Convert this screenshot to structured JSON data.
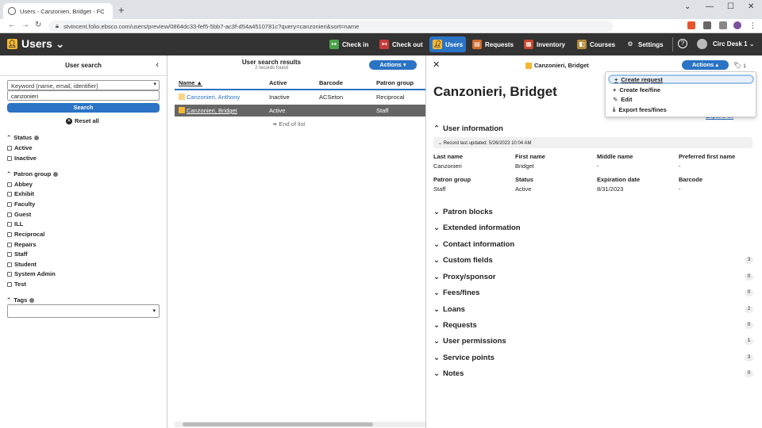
{
  "browser": {
    "tab_title": "Users - Canzonieri, Bridget - FOLIO",
    "url": "stvincent.folio.ebsco.com/users/preview/0864dc33-fef5-5bb7-ac3f-d54a4510781c?query=canzonieri&sort=name"
  },
  "app": {
    "name": "Users",
    "nav": [
      {
        "label": "Check in",
        "color": "#4aa34a"
      },
      {
        "label": "Check out",
        "color": "#c63a3a"
      },
      {
        "label": "Users",
        "color": "#f5b731"
      },
      {
        "label": "Requests",
        "color": "#d06d2d"
      },
      {
        "label": "Inventory",
        "color": "#c8442c"
      },
      {
        "label": "Courses",
        "color": "#b58b3a"
      },
      {
        "label": "Settings",
        "color": "#333"
      }
    ],
    "service_point": "Circ Desk 1"
  },
  "search": {
    "title": "User search",
    "keyword_placeholder": "Keyword (name, email, identifier)",
    "query": "canzonieri",
    "search_label": "Search",
    "reset_label": "Reset all",
    "status_label": "Status",
    "status_options": [
      "Active",
      "Inactive"
    ],
    "patron_group_label": "Patron group",
    "patron_groups": [
      "Abbey",
      "Exhibit",
      "Faculty",
      "Guest",
      "ILL",
      "Reciprocal",
      "Repairs",
      "Staff",
      "Student",
      "System Admin",
      "Test"
    ],
    "tags_label": "Tags"
  },
  "results": {
    "title": "User search results",
    "count": "2 records found",
    "actions_label": "Actions",
    "columns": [
      "Name",
      "Active",
      "Barcode",
      "Patron group"
    ],
    "rows": [
      {
        "name": "Canzonieri, Anthony",
        "active": "Inactive",
        "barcode": "ACSeton",
        "group": "Reciprocal"
      },
      {
        "name": "Canzonieri, Bridget",
        "active": "Active",
        "barcode": "",
        "group": "Staff"
      }
    ],
    "end_label": "End of list"
  },
  "detail": {
    "header_name": "Canzonieri, Bridget",
    "actions_label": "Actions",
    "tag_count": "1",
    "full_name": "Canzonieri, Bridget",
    "expand_all": "Expand all",
    "user_info_label": "User information",
    "record_updated": "Record last updated: 5/26/2023 10:04 AM",
    "fields": [
      {
        "label": "Last name",
        "value": "Canzonieri"
      },
      {
        "label": "First name",
        "value": "Bridget"
      },
      {
        "label": "Middle name",
        "value": "-"
      },
      {
        "label": "Preferred first name",
        "value": "-"
      },
      {
        "label": "Patron group",
        "value": "Staff"
      },
      {
        "label": "Status",
        "value": "Active"
      },
      {
        "label": "Expiration date",
        "value": "8/31/2023"
      },
      {
        "label": "Barcode",
        "value": "-"
      }
    ],
    "sections": [
      {
        "label": "Patron blocks",
        "count": ""
      },
      {
        "label": "Extended information",
        "count": ""
      },
      {
        "label": "Contact information",
        "count": ""
      },
      {
        "label": "Custom fields",
        "count": "3"
      },
      {
        "label": "Proxy/sponsor",
        "count": "0"
      },
      {
        "label": "Fees/fines",
        "count": "0"
      },
      {
        "label": "Loans",
        "count": "2"
      },
      {
        "label": "Requests",
        "count": "0"
      },
      {
        "label": "User permissions",
        "count": "1"
      },
      {
        "label": "Service points",
        "count": "3"
      },
      {
        "label": "Notes",
        "count": "0"
      }
    ]
  },
  "menu": {
    "items": [
      "Create request",
      "Create fee/fine",
      "Edit",
      "Export fees/fines"
    ]
  }
}
